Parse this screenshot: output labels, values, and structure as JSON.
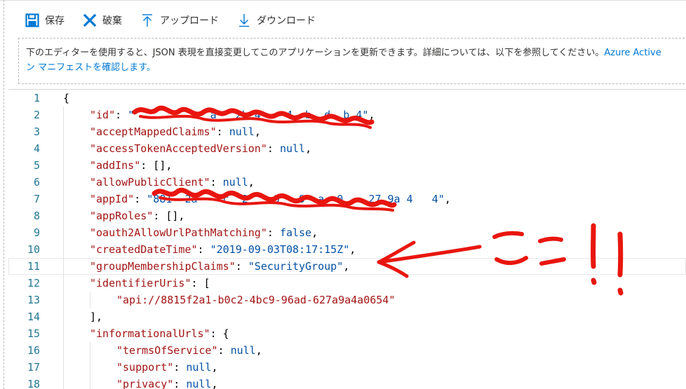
{
  "toolbar": {
    "save_label": "保存",
    "discard_label": "破棄",
    "upload_label": "アップロード",
    "download_label": "ダウンロード"
  },
  "banner": {
    "line1_text": "下のエディターを使用すると、JSON 表現を直接変更してこのアプリケーションを更新できます。詳細については、以下を参照してください。",
    "line1_link": "Azure Active",
    "line2_link": "ン マニフェストを確認します。"
  },
  "editor": {
    "current_line": 11,
    "lines": [
      {
        "n": "1",
        "indent": 0,
        "parts": [
          {
            "t": "{",
            "c": "p"
          }
        ]
      },
      {
        "n": "2",
        "indent": 1,
        "parts": [
          {
            "t": "\"id\"",
            "c": "k"
          },
          {
            "t": ": ",
            "c": "p"
          },
          {
            "t": "\"            a   2b 4    4  b  d  b 4\"",
            "c": "s"
          },
          {
            "t": ",",
            "c": "p"
          }
        ]
      },
      {
        "n": "3",
        "indent": 1,
        "parts": [
          {
            "t": "\"acceptMappedClaims\"",
            "c": "k"
          },
          {
            "t": ": ",
            "c": "p"
          },
          {
            "t": "null",
            "c": "lit"
          },
          {
            "t": ",",
            "c": "p"
          }
        ]
      },
      {
        "n": "4",
        "indent": 1,
        "parts": [
          {
            "t": "\"accessTokenAcceptedVersion\"",
            "c": "k"
          },
          {
            "t": ": ",
            "c": "p"
          },
          {
            "t": "null",
            "c": "lit"
          },
          {
            "t": ",",
            "c": "p"
          }
        ]
      },
      {
        "n": "5",
        "indent": 1,
        "parts": [
          {
            "t": "\"addIns\"",
            "c": "k"
          },
          {
            "t": ": [],",
            "c": "p"
          }
        ]
      },
      {
        "n": "6",
        "indent": 1,
        "parts": [
          {
            "t": "\"allowPublicClient\"",
            "c": "k"
          },
          {
            "t": ": ",
            "c": "p"
          },
          {
            "t": "null",
            "c": "lit"
          },
          {
            "t": ",",
            "c": "p"
          }
        ]
      },
      {
        "n": "7",
        "indent": 1,
        "parts": [
          {
            "t": "\"appId\"",
            "c": "k"
          },
          {
            "t": ": ",
            "c": "p"
          },
          {
            "t": "\"881  2a    c  2    9   9  a  0    27 9a 4   4\"",
            "c": "s"
          },
          {
            "t": ",",
            "c": "p"
          }
        ]
      },
      {
        "n": "8",
        "indent": 1,
        "parts": [
          {
            "t": "\"appRoles\"",
            "c": "k"
          },
          {
            "t": ": [],",
            "c": "p"
          }
        ]
      },
      {
        "n": "9",
        "indent": 1,
        "parts": [
          {
            "t": "\"oauth2AllowUrlPathMatching\"",
            "c": "k"
          },
          {
            "t": ": ",
            "c": "p"
          },
          {
            "t": "false",
            "c": "lit"
          },
          {
            "t": ",",
            "c": "p"
          }
        ]
      },
      {
        "n": "10",
        "indent": 1,
        "parts": [
          {
            "t": "\"createdDateTime\"",
            "c": "k"
          },
          {
            "t": ": ",
            "c": "p"
          },
          {
            "t": "\"2019-09-03T08:17:15Z\"",
            "c": "s"
          },
          {
            "t": ",",
            "c": "p"
          }
        ]
      },
      {
        "n": "11",
        "indent": 1,
        "parts": [
          {
            "t": "\"groupMembershipClaims\"",
            "c": "k"
          },
          {
            "t": ": ",
            "c": "p"
          },
          {
            "t": "\"SecurityGroup\"",
            "c": "s"
          },
          {
            "t": ",",
            "c": "p"
          }
        ]
      },
      {
        "n": "12",
        "indent": 1,
        "parts": [
          {
            "t": "\"identifierUris\"",
            "c": "k"
          },
          {
            "t": ": [",
            "c": "p"
          }
        ]
      },
      {
        "n": "13",
        "indent": 2,
        "parts": [
          {
            "t": "\"api://8815f2a1-b0c2-4bc9-96ad-627a9a4a0654\"",
            "c": "k"
          }
        ]
      },
      {
        "n": "14",
        "indent": 1,
        "parts": [
          {
            "t": "],",
            "c": "p"
          }
        ]
      },
      {
        "n": "15",
        "indent": 1,
        "parts": [
          {
            "t": "\"informationalUrls\"",
            "c": "k"
          },
          {
            "t": ": {",
            "c": "p"
          }
        ]
      },
      {
        "n": "16",
        "indent": 2,
        "parts": [
          {
            "t": "\"termsOfService\"",
            "c": "k"
          },
          {
            "t": ": ",
            "c": "p"
          },
          {
            "t": "null",
            "c": "lit"
          },
          {
            "t": ",",
            "c": "p"
          }
        ]
      },
      {
        "n": "17",
        "indent": 2,
        "parts": [
          {
            "t": "\"support\"",
            "c": "k"
          },
          {
            "t": ": ",
            "c": "p"
          },
          {
            "t": "null",
            "c": "lit"
          },
          {
            "t": ",",
            "c": "p"
          }
        ]
      },
      {
        "n": "18",
        "indent": 2,
        "parts": [
          {
            "t": "\"privacy\"",
            "c": "k"
          },
          {
            "t": ": ",
            "c": "p"
          },
          {
            "t": "null",
            "c": "lit"
          },
          {
            "t": ",",
            "c": "p"
          }
        ]
      }
    ]
  },
  "annotation": {
    "text": "ここ!!",
    "color": "#e8160f"
  },
  "colors": {
    "accent": "#0078d4",
    "key": "#a31515",
    "value": "#0451a5",
    "line_number": "#237893"
  },
  "icons": [
    "save-icon",
    "discard-icon",
    "upload-icon",
    "download-icon"
  ]
}
